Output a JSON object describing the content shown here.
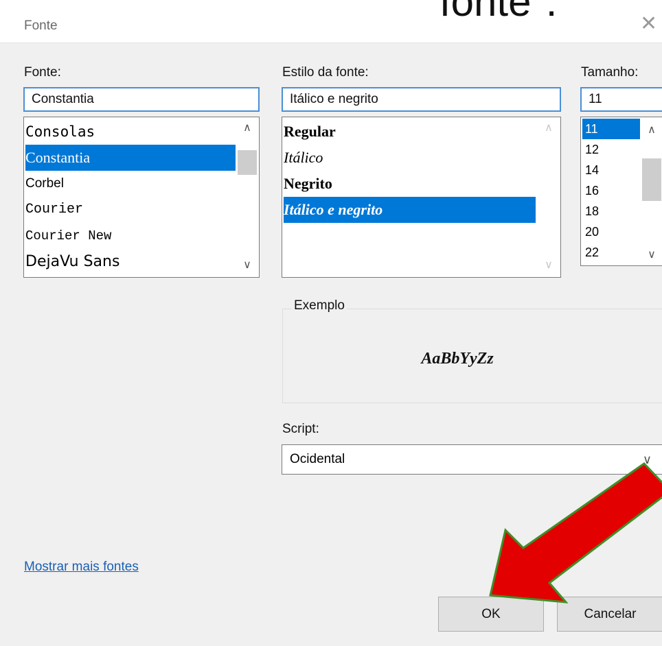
{
  "window": {
    "title": "Fonte",
    "overlay_caption": "fonte\".",
    "close_glyph": "✕"
  },
  "font": {
    "label": "Fonte:",
    "value": "Constantia",
    "items": [
      {
        "label": "Consolas",
        "selected": false
      },
      {
        "label": "Constantia",
        "selected": true
      },
      {
        "label": "Corbel",
        "selected": false
      },
      {
        "label": "Courier",
        "selected": false
      },
      {
        "label": "Courier New",
        "selected": false
      },
      {
        "label": "DejaVu Sans",
        "selected": false
      }
    ]
  },
  "style": {
    "label": "Estilo da fonte:",
    "value": "Itálico e negrito",
    "items": [
      {
        "label": "Regular",
        "selected": false
      },
      {
        "label": "Itálico",
        "selected": false
      },
      {
        "label": "Negrito",
        "selected": false
      },
      {
        "label": "Itálico e negrito",
        "selected": true
      }
    ]
  },
  "size": {
    "label": "Tamanho:",
    "value": "11",
    "items": [
      {
        "label": "11",
        "selected": true
      },
      {
        "label": "12",
        "selected": false
      },
      {
        "label": "14",
        "selected": false
      },
      {
        "label": "16",
        "selected": false
      },
      {
        "label": "18",
        "selected": false
      },
      {
        "label": "20",
        "selected": false
      },
      {
        "label": "22",
        "selected": false
      }
    ]
  },
  "sample": {
    "legend": "Exemplo",
    "text": "AaBbYyZz"
  },
  "script": {
    "label": "Script:",
    "value": "Ocidental"
  },
  "links": {
    "more_fonts": "Mostrar mais fontes"
  },
  "buttons": {
    "ok": "OK",
    "cancel": "Cancelar"
  },
  "colors": {
    "selection": "#0078d7",
    "annotation_arrow": "#e30000",
    "annotation_arrow_outline": "#3f8f2a"
  }
}
